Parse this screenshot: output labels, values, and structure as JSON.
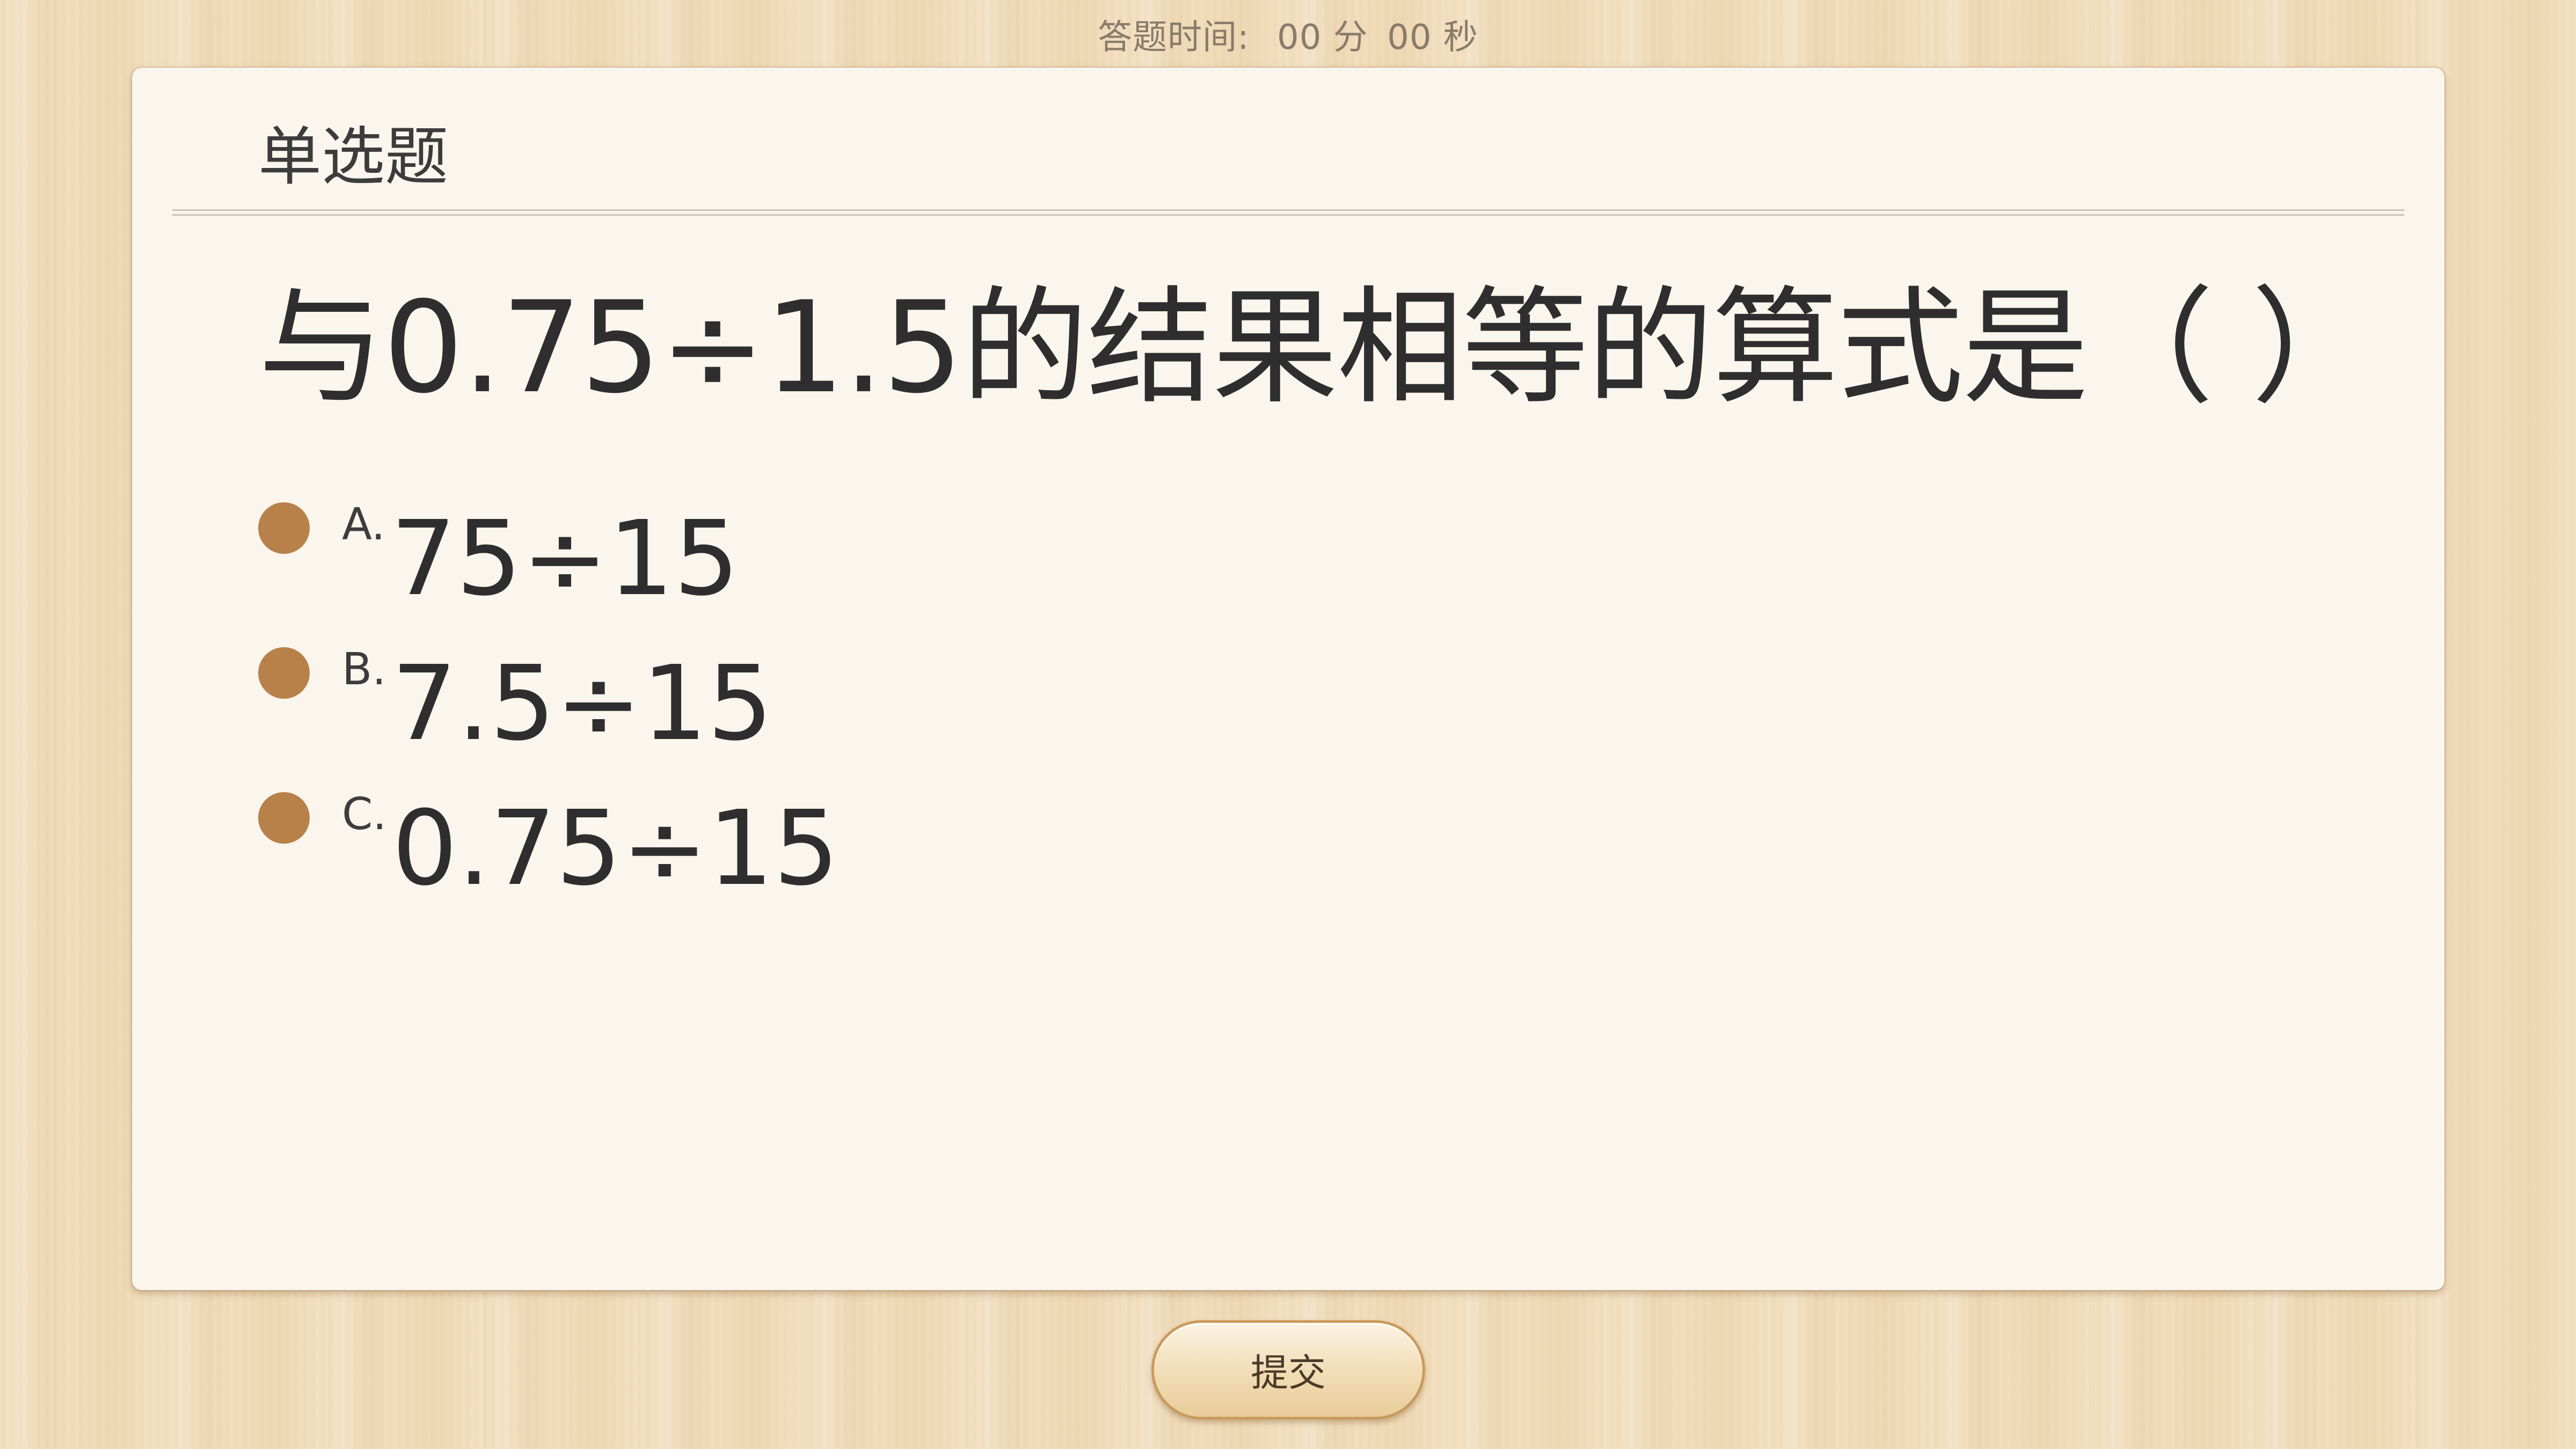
{
  "timer": {
    "label": "答题时间:",
    "minutes": "00",
    "minutes_unit": "分",
    "seconds": "00",
    "seconds_unit": "秒"
  },
  "card": {
    "type_label": "单选题",
    "question": "与0.75÷1.5的结果相等的算式是（    ）"
  },
  "options": [
    {
      "letter": "A.",
      "text": "75÷15"
    },
    {
      "letter": "B.",
      "text": "7.5÷15"
    },
    {
      "letter": "C.",
      "text": "0.75÷15"
    }
  ],
  "submit_label": "提交",
  "colors": {
    "radio": "#b8814a",
    "card_bg": "#faf5ed",
    "wood": "#f3dfbe"
  }
}
